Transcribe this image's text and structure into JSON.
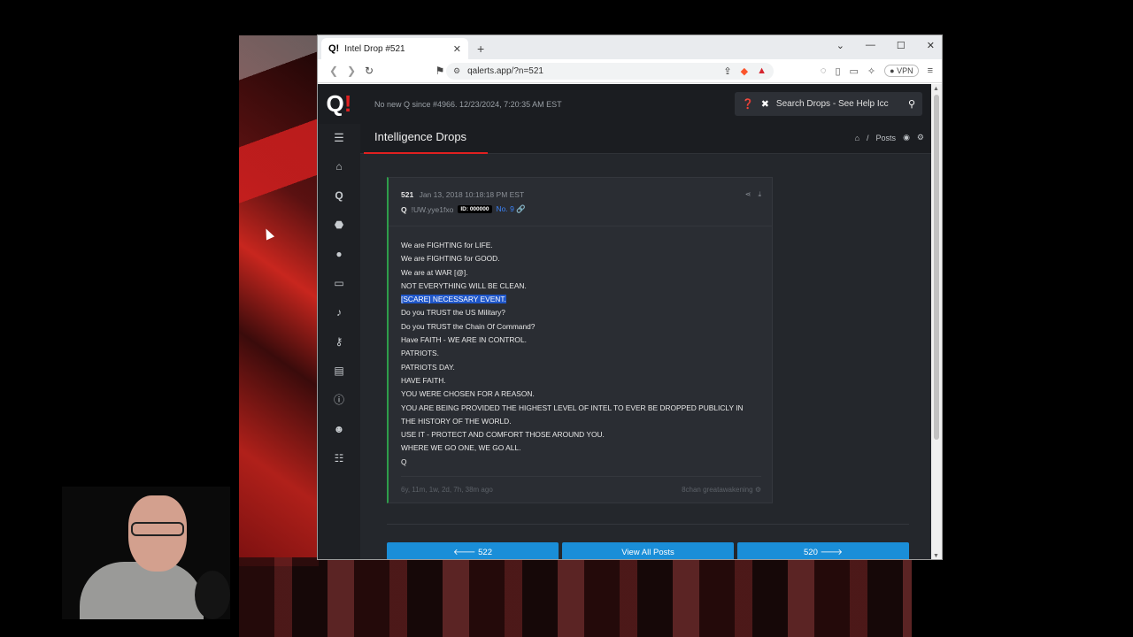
{
  "browser": {
    "tab_title": "Intel Drop #521",
    "tab_favicon": "Q!",
    "new_tab": "+",
    "url": "qalerts.app/?n=521",
    "vpn_label": "VPN"
  },
  "site": {
    "logo_q": "Q",
    "logo_bang": "!",
    "notice": "No new Q since #4966. 12/23/2024, 7:20:35 AM EST",
    "search_placeholder": "Search Drops - See Help Icc",
    "section_title": "Intelligence Drops",
    "breadcrumb": {
      "home_sep": "/",
      "current": "Posts"
    }
  },
  "sidebar_icons": [
    "menu-icon",
    "home-icon",
    "q-icon",
    "android-icon",
    "apple-icon",
    "desktop-icon",
    "bell-icon",
    "key-icon",
    "toolbox-icon",
    "info-icon",
    "user-secret-icon",
    "users-icon"
  ],
  "post": {
    "number": "521",
    "date": "Jan 13, 2018 10:18:18 PM EST",
    "author": "Q",
    "tripcode": "!UW.yye1fxo",
    "id_badge": "ID: 000000",
    "no": "No. 9",
    "lines": [
      "We are FIGHTING for LIFE.",
      "We are FIGHTING for GOOD.",
      "We are at WAR [@].",
      "NOT EVERYTHING WILL BE CLEAN.",
      "[SCARE] NECESSARY EVENT.",
      "Do you TRUST the US Military?",
      "Do you TRUST the Chain Of Command?",
      "Have FAITH - WE ARE IN CONTROL.",
      "PATRIOTS.",
      "PATRIOTS DAY.",
      "HAVE FAITH.",
      "YOU WERE CHOSEN FOR A REASON.",
      "YOU ARE BEING PROVIDED THE HIGHEST LEVEL OF INTEL TO EVER BE DROPPED PUBLICLY IN THE HISTORY OF THE WORLD.",
      "USE IT - PROTECT AND COMFORT THOSE AROUND YOU.",
      "WHERE WE GO ONE, WE GO ALL.",
      "Q"
    ],
    "age": "6y, 11m, 1w, 2d, 7h, 38m ago",
    "source": "8chan greatawakening"
  },
  "pager": {
    "prev": "522",
    "all": "View All Posts",
    "next": "520"
  }
}
